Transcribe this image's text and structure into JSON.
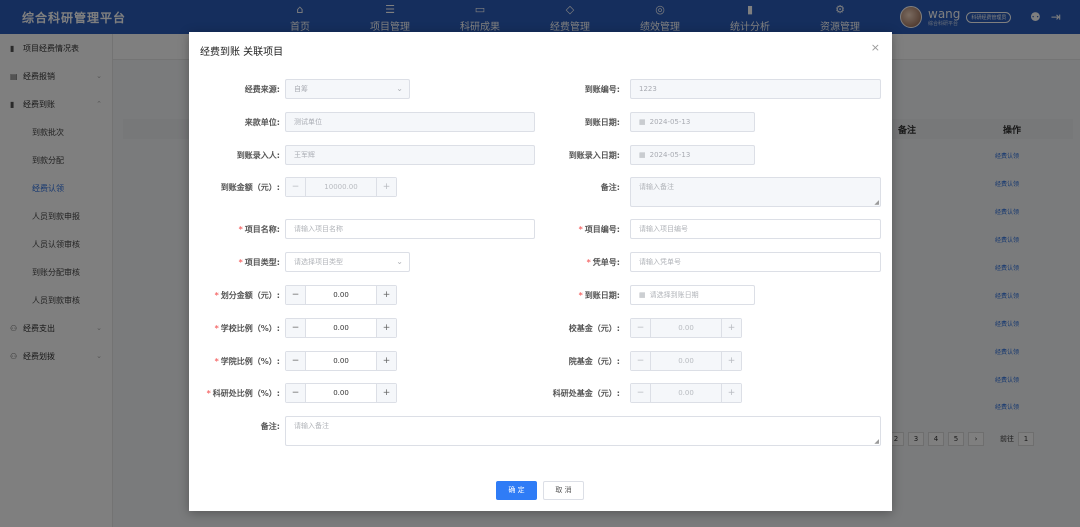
{
  "header": {
    "brand": "综合科研管理平台",
    "nav": [
      {
        "icon": "⌂",
        "label": "首页"
      },
      {
        "icon": "☰",
        "label": "项目管理"
      },
      {
        "icon": "▭",
        "label": "科研成果"
      },
      {
        "icon": "◇",
        "label": "经费管理"
      },
      {
        "icon": "◎",
        "label": "绩效管理"
      },
      {
        "icon": "▮",
        "label": "统计分析"
      },
      {
        "icon": "⚙",
        "label": "资源管理"
      }
    ],
    "user": {
      "name": "wang",
      "sub": "综合科研平台",
      "role": "科研经费管理员"
    }
  },
  "sidebar": {
    "items": [
      {
        "icon": "▮",
        "label": "项目经费情况表"
      },
      {
        "icon": "▤",
        "label": "经费报销"
      },
      {
        "icon": "▮",
        "label": "经费到账"
      },
      {
        "label": "到款批次"
      },
      {
        "label": "到款分配"
      },
      {
        "label": "经费认领"
      },
      {
        "label": "人员到款申报"
      },
      {
        "label": "人员认领审核"
      },
      {
        "label": "到账分配审核"
      },
      {
        "label": "人员到款审核"
      },
      {
        "icon": "⚇",
        "label": "经费支出"
      },
      {
        "icon": "⚇",
        "label": "经费划拨"
      }
    ]
  },
  "background": {
    "col_note": "备注",
    "col_op": "操作",
    "action": "经费认领",
    "pages": [
      "2",
      "3",
      "4",
      "5",
      "›"
    ],
    "goto": "前往",
    "page_input": "1"
  },
  "dialog": {
    "title": "经费到账 关联项目",
    "left": {
      "source_label": "经费来源:",
      "source_value": "自筹",
      "payer_label": "来款单位:",
      "payer_value": "测试单位",
      "recorder_label": "到账录入人:",
      "recorder_value": "王军辉",
      "amount_label": "到账金额（元）:",
      "amount_value": "10000.00",
      "project_name_label": "项目名称:",
      "project_name_ph": "请输入项目名称",
      "project_type_label": "项目类型:",
      "project_type_ph": "请选择项目类型",
      "alloc_amount_label": "划分金额（元）:",
      "alloc_amount_value": "0.00",
      "school_ratio_label": "学校比例（%）:",
      "school_ratio_value": "0.00",
      "college_ratio_label": "学院比例（%）:",
      "college_ratio_value": "0.00",
      "research_ratio_label": "科研处比例（%）:",
      "research_ratio_value": "0.00",
      "note_label": "备注:",
      "note_ph": "请输入备注"
    },
    "right": {
      "arrival_no_label": "到账编号:",
      "arrival_no_value": "1223",
      "arrival_date_label": "到账日期:",
      "arrival_date_value": "2024-05-13",
      "entry_date_label": "到账录入日期:",
      "entry_date_value": "2024-05-13",
      "note_label": "备注:",
      "note_ph": "请输入备注",
      "project_no_label": "项目编号:",
      "project_no_ph": "请输入项目编号",
      "voucher_label": "凭单号:",
      "voucher_ph": "请输入凭单号",
      "arr_date2_label": "到账日期:",
      "arr_date2_ph": "请选择到账日期",
      "school_fund_label": "校基金（元）:",
      "school_fund_value": "0.00",
      "college_fund_label": "院基金（元）:",
      "college_fund_value": "0.00",
      "research_fund_label": "科研处基金（元）:",
      "research_fund_value": "0.00"
    },
    "ok": "确 定",
    "cancel": "取 消"
  }
}
